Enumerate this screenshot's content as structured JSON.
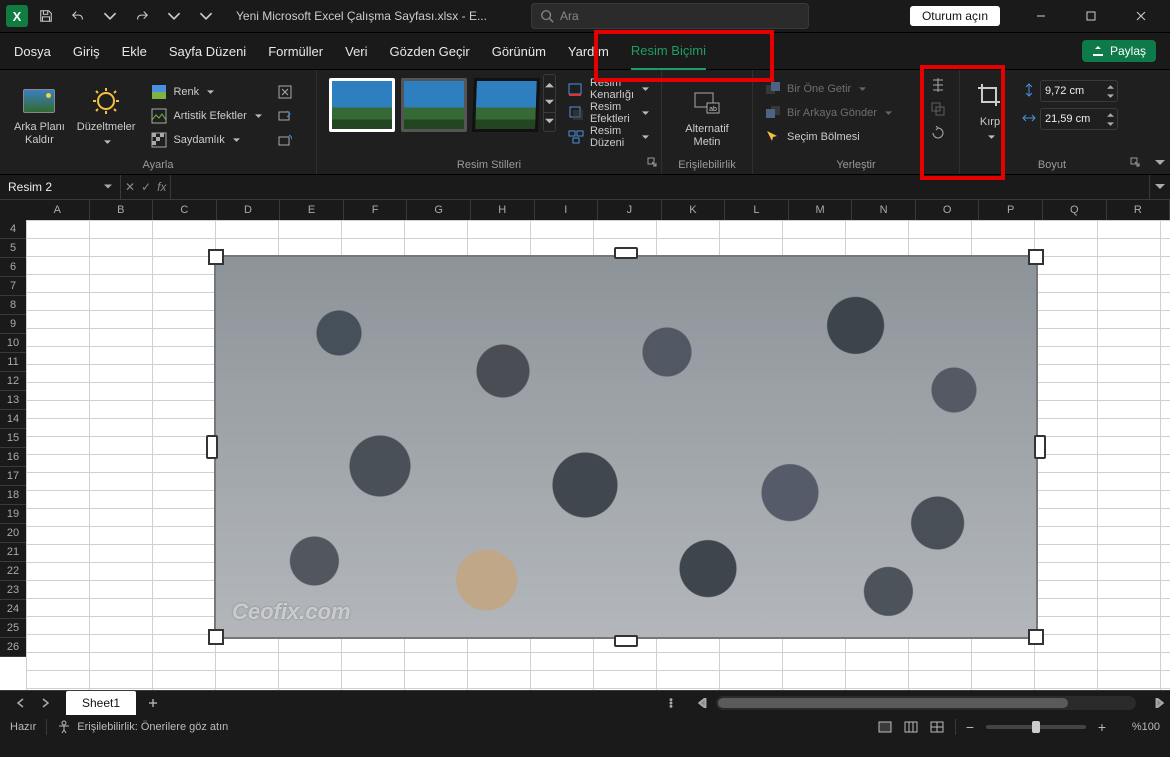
{
  "titlebar": {
    "title": "Yeni Microsoft Excel Çalışma Sayfası.xlsx  -  E...",
    "search_placeholder": "Ara",
    "sign_in": "Oturum açın"
  },
  "tabs": {
    "file": "Dosya",
    "home": "Giriş",
    "insert": "Ekle",
    "layout": "Sayfa Düzeni",
    "formulas": "Formüller",
    "data": "Veri",
    "review": "Gözden Geçir",
    "view": "Görünüm",
    "help": "Yardım",
    "picfmt": "Resim Biçimi"
  },
  "share": "Paylaş",
  "ribbon": {
    "adjust": {
      "remove_bg": "Arka Planı\nKaldır",
      "corrections": "Düzeltmeler",
      "color": "Renk",
      "artistic": "Artistik Efektler",
      "transparency": "Saydamlık",
      "label": "Ayarla"
    },
    "styles": {
      "label": "Resim Stilleri",
      "border": "Resim Kenarlığı",
      "effects": "Resim Efektleri",
      "layout": "Resim Düzeni"
    },
    "acc": {
      "alt": "Alternatif\nMetin",
      "label": "Erişilebilirlik"
    },
    "arrange": {
      "bring_fw": "Bir Öne Getir",
      "send_bk": "Bir Arkaya Gönder",
      "selection": "Seçim Bölmesi",
      "label": "Yerleştir"
    },
    "size": {
      "crop": "Kırp",
      "height": "9,72 cm",
      "width": "21,59 cm",
      "label": "Boyut"
    }
  },
  "namebox": "Resim 2",
  "columns": [
    "A",
    "B",
    "C",
    "D",
    "E",
    "F",
    "G",
    "H",
    "I",
    "J",
    "K",
    "L",
    "M",
    "N",
    "O",
    "P",
    "Q",
    "R"
  ],
  "rows": [
    "4",
    "5",
    "6",
    "7",
    "8",
    "9",
    "10",
    "11",
    "12",
    "13",
    "14",
    "15",
    "16",
    "17",
    "18",
    "19",
    "20",
    "21",
    "22",
    "23",
    "24",
    "25",
    "26"
  ],
  "watermark": "Ceofix.com",
  "sheet": {
    "name": "Sheet1"
  },
  "status": {
    "ready": "Hazır",
    "accessibility": "Erişilebilirlik: Önerilere göz atın",
    "zoom": "%100"
  }
}
